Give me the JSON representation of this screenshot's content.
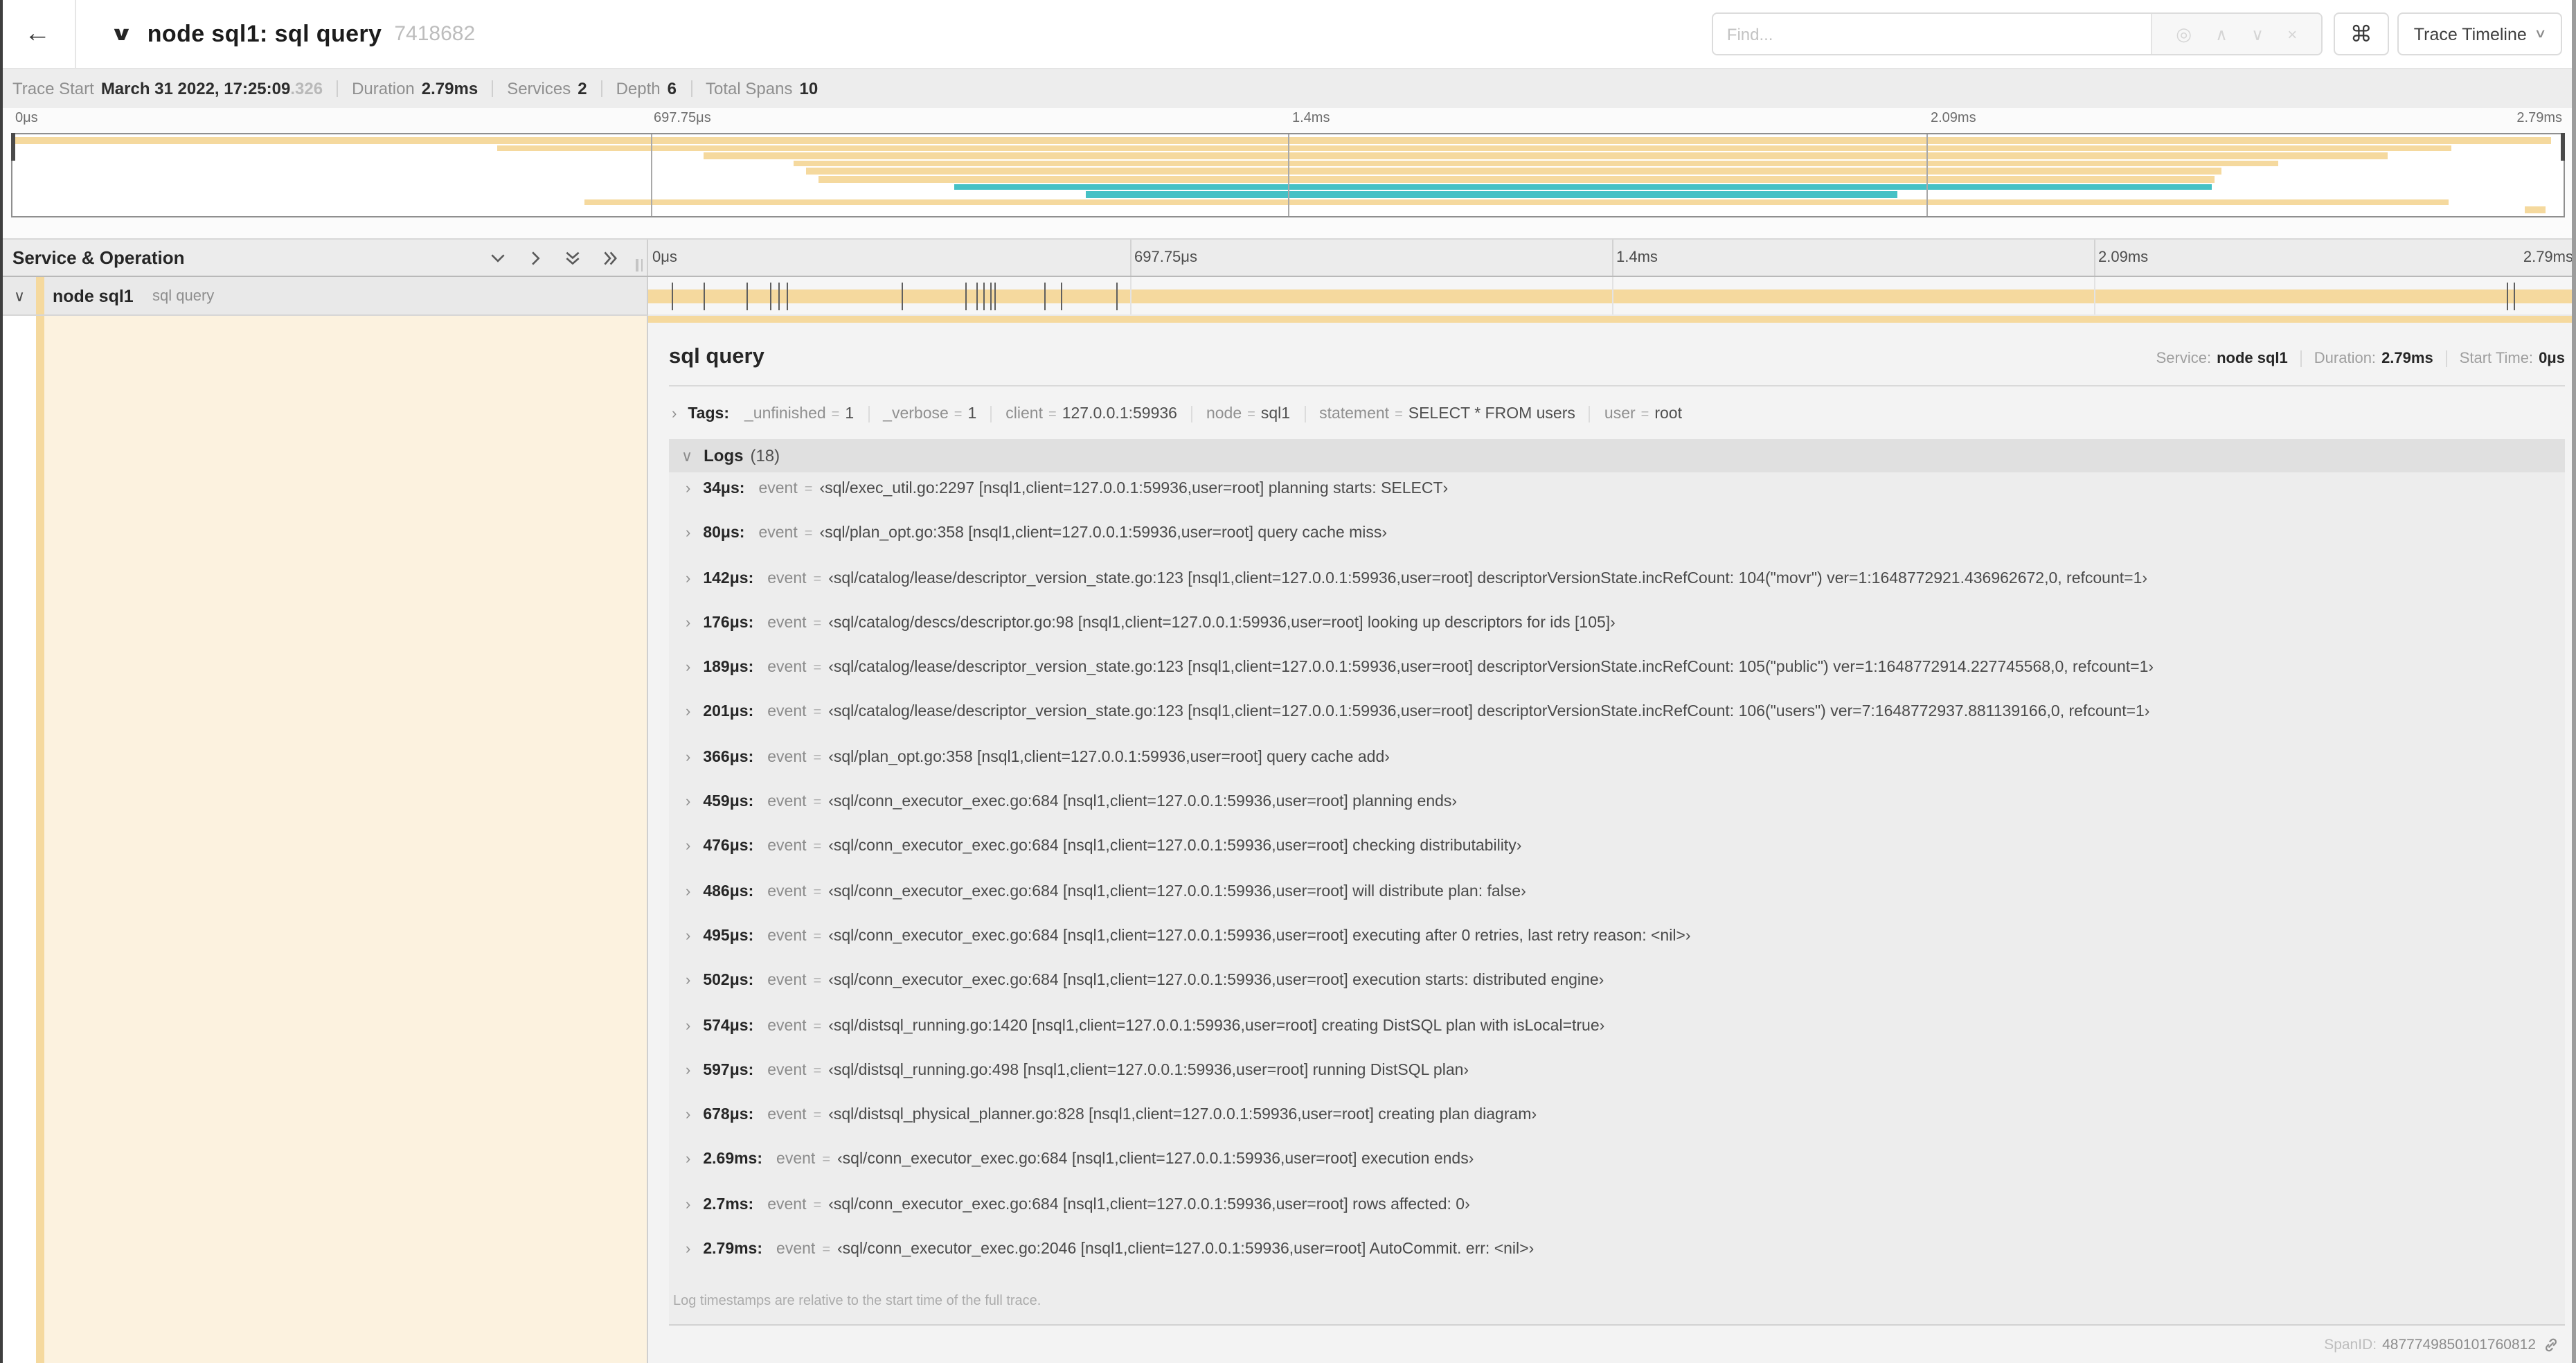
{
  "colors": {
    "span_tan": "#F5D99E",
    "span_teal": "#46C1C5",
    "detail_tint": "rgba(245,217,158,0.33)"
  },
  "ui": {
    "icons": {
      "back": "←",
      "title_chevron": "∨",
      "chevron_down": "∨",
      "chevron_right": "›",
      "locate": "◎",
      "prev": "∧",
      "next": "∨",
      "clear": "×",
      "command": "⌘",
      "dropdown_caret": "∨"
    },
    "eq": "=",
    "colon": ":",
    "quote_open": "‹",
    "quote_close": "›"
  },
  "header": {
    "title": "node sql1: sql query",
    "trace_id": "7418682",
    "find_placeholder": "Find...",
    "view_button": "Trace Timeline"
  },
  "summary": {
    "items": [
      {
        "label": "Trace Start",
        "value": "March 31 2022, 17:25:09",
        "suffix": ".326"
      },
      {
        "label": "Duration",
        "value": "2.79ms"
      },
      {
        "label": "Services",
        "value": "2"
      },
      {
        "label": "Depth",
        "value": "6"
      },
      {
        "label": "Total Spans",
        "value": "10"
      }
    ]
  },
  "timeline": {
    "ticks": [
      "0μs",
      "697.75μs",
      "1.4ms",
      "2.09ms",
      "2.79ms"
    ],
    "tick_positions": [
      0,
      25,
      50,
      75,
      100
    ],
    "minimap_spans": [
      {
        "start": 0.0,
        "end": 0.995,
        "color": "span_tan"
      },
      {
        "start": 0.19,
        "end": 0.956,
        "color": "span_tan"
      },
      {
        "start": 0.271,
        "end": 0.931,
        "color": "span_tan"
      },
      {
        "start": 0.306,
        "end": 0.888,
        "color": "span_tan"
      },
      {
        "start": 0.311,
        "end": 0.866,
        "color": "span_tan"
      },
      {
        "start": 0.316,
        "end": 0.863,
        "color": "span_tan"
      },
      {
        "start": 0.369,
        "end": 0.862,
        "color": "span_teal"
      },
      {
        "start": 0.421,
        "end": 0.739,
        "color": "span_teal"
      },
      {
        "start": 0.224,
        "end": 0.955,
        "color": "span_tan"
      },
      {
        "start": 0.985,
        "end": 0.993,
        "color": "span_tan"
      }
    ],
    "log_marker_fracs": [
      0.0122,
      0.0287,
      0.0509,
      0.0631,
      0.0677,
      0.072,
      0.1312,
      0.1645,
      0.1706,
      0.1742,
      0.1774,
      0.1799,
      0.2057,
      0.214,
      0.243,
      0.9642,
      0.9677
    ]
  },
  "tree": {
    "column_header": "Service & Operation",
    "rows": [
      {
        "service": "node sql1",
        "operation": "sql query"
      }
    ]
  },
  "detail": {
    "title": "sql query",
    "overview": [
      {
        "label": "Service:",
        "value": "node sql1"
      },
      {
        "label": "Duration:",
        "value": "2.79ms"
      },
      {
        "label": "Start Time:",
        "value": "0μs"
      }
    ],
    "tags_label": "Tags:",
    "tags": [
      {
        "key": "_unfinished",
        "value": "1"
      },
      {
        "key": "_verbose",
        "value": "1"
      },
      {
        "key": "client",
        "value": "127.0.0.1:59936"
      },
      {
        "key": "node",
        "value": "sql1"
      },
      {
        "key": "statement",
        "value": "SELECT * FROM users"
      },
      {
        "key": "user",
        "value": "root"
      }
    ],
    "logs_label": "Logs",
    "logs_count": "(18)",
    "log_field": "event",
    "logs": [
      {
        "time": "34μs",
        "value": "sql/exec_util.go:2297 [nsql1,client=127.0.0.1:59936,user=root] planning starts: SELECT"
      },
      {
        "time": "80μs",
        "value": "sql/plan_opt.go:358 [nsql1,client=127.0.0.1:59936,user=root] query cache miss"
      },
      {
        "time": "142μs",
        "value": "sql/catalog/lease/descriptor_version_state.go:123 [nsql1,client=127.0.0.1:59936,user=root] descriptorVersionState.incRefCount: 104(\"movr\") ver=1:1648772921.436962672,0, refcount=1"
      },
      {
        "time": "176μs",
        "value": "sql/catalog/descs/descriptor.go:98 [nsql1,client=127.0.0.1:59936,user=root] looking up descriptors for ids [105]"
      },
      {
        "time": "189μs",
        "value": "sql/catalog/lease/descriptor_version_state.go:123 [nsql1,client=127.0.0.1:59936,user=root] descriptorVersionState.incRefCount: 105(\"public\") ver=1:1648772914.227745568,0, refcount=1"
      },
      {
        "time": "201μs",
        "value": "sql/catalog/lease/descriptor_version_state.go:123 [nsql1,client=127.0.0.1:59936,user=root] descriptorVersionState.incRefCount: 106(\"users\") ver=7:1648772937.881139166,0, refcount=1"
      },
      {
        "time": "366μs",
        "value": "sql/plan_opt.go:358 [nsql1,client=127.0.0.1:59936,user=root] query cache add"
      },
      {
        "time": "459μs",
        "value": "sql/conn_executor_exec.go:684 [nsql1,client=127.0.0.1:59936,user=root] planning ends"
      },
      {
        "time": "476μs",
        "value": "sql/conn_executor_exec.go:684 [nsql1,client=127.0.0.1:59936,user=root] checking distributability"
      },
      {
        "time": "486μs",
        "value": "sql/conn_executor_exec.go:684 [nsql1,client=127.0.0.1:59936,user=root] will distribute plan: false"
      },
      {
        "time": "495μs",
        "value": "sql/conn_executor_exec.go:684 [nsql1,client=127.0.0.1:59936,user=root] executing after 0 retries, last retry reason: <nil>"
      },
      {
        "time": "502μs",
        "value": "sql/conn_executor_exec.go:684 [nsql1,client=127.0.0.1:59936,user=root] execution starts: distributed engine"
      },
      {
        "time": "574μs",
        "value": "sql/distsql_running.go:1420 [nsql1,client=127.0.0.1:59936,user=root] creating DistSQL plan with isLocal=true"
      },
      {
        "time": "597μs",
        "value": "sql/distsql_running.go:498 [nsql1,client=127.0.0.1:59936,user=root] running DistSQL plan"
      },
      {
        "time": "678μs",
        "value": "sql/distsql_physical_planner.go:828 [nsql1,client=127.0.0.1:59936,user=root] creating plan diagram"
      },
      {
        "time": "2.69ms",
        "value": "sql/conn_executor_exec.go:684 [nsql1,client=127.0.0.1:59936,user=root] execution ends"
      },
      {
        "time": "2.7ms",
        "value": "sql/conn_executor_exec.go:684 [nsql1,client=127.0.0.1:59936,user=root] rows affected: 0"
      },
      {
        "time": "2.79ms",
        "value": "sql/conn_executor_exec.go:2046 [nsql1,client=127.0.0.1:59936,user=root] AutoCommit. err: <nil>"
      }
    ],
    "footer_note": "Log timestamps are relative to the start time of the full trace.",
    "spanid_label": "SpanID:",
    "spanid": "4877749850101760812"
  }
}
